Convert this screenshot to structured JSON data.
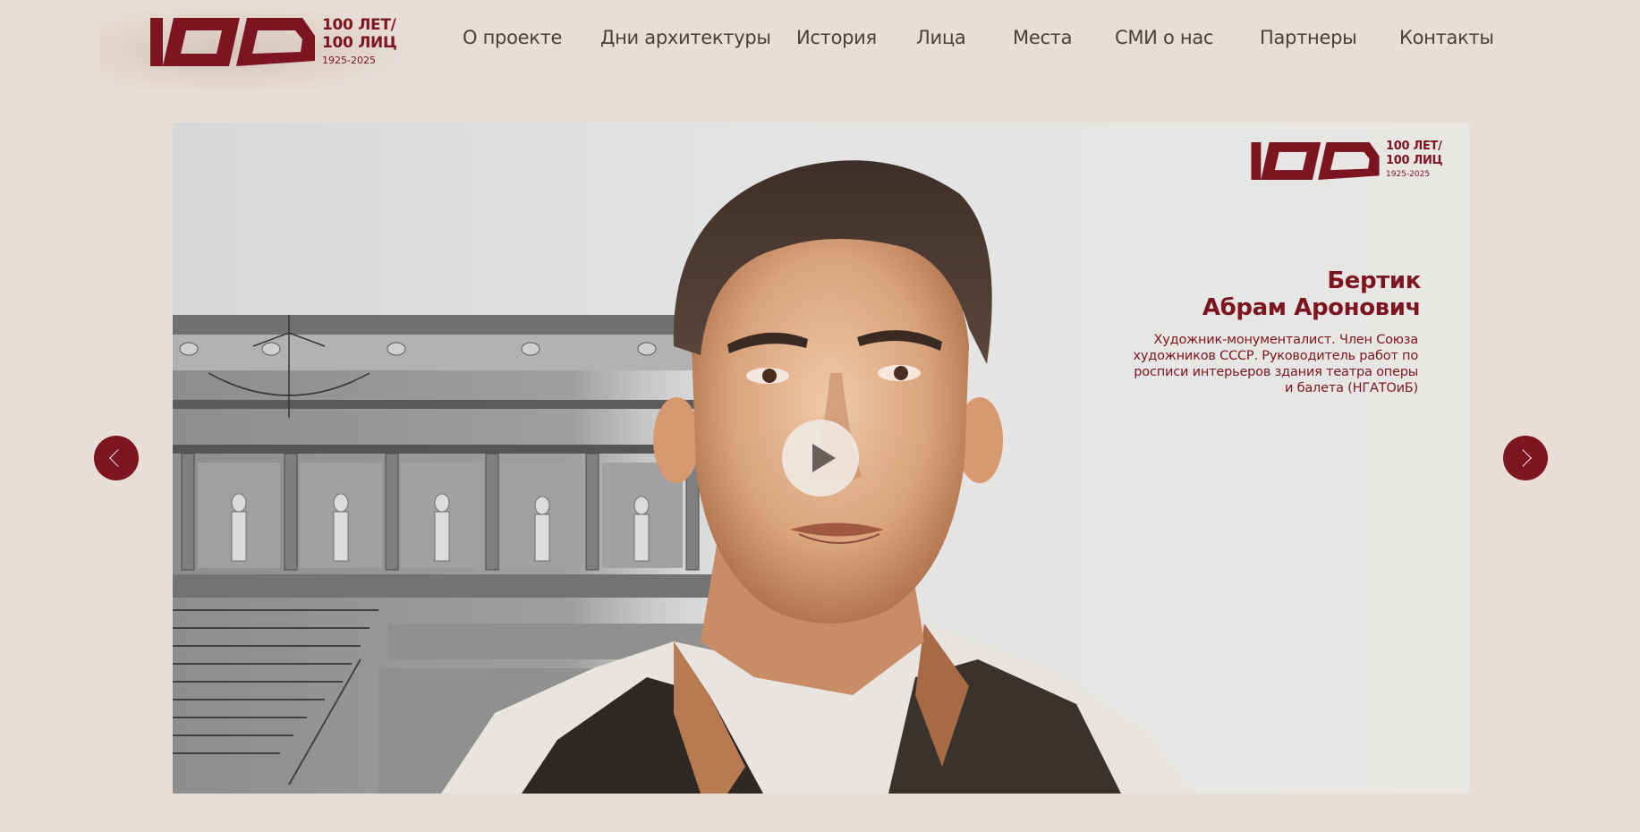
{
  "colors": {
    "background": "#e8ded5",
    "brand": "#7d1520",
    "nav_text": "#4a3f3b"
  },
  "header": {
    "logo": {
      "mark_text": "100",
      "line1": "100 ЛЕТ/",
      "line2": "100 ЛИЦ",
      "years": "1925-2025"
    },
    "nav": [
      {
        "label": "О проекте"
      },
      {
        "label": "Дни архитектуры"
      },
      {
        "label": "История"
      },
      {
        "label": "Лица"
      },
      {
        "label": "Места"
      },
      {
        "label": "СМИ о нас"
      },
      {
        "label": "Партнеры"
      },
      {
        "label": "Контакты"
      }
    ]
  },
  "slide": {
    "logo": {
      "line1": "100 ЛЕТ/",
      "line2": "100 ЛИЦ",
      "years": "1925-2025"
    },
    "name_line1": "Бертик",
    "name_line2": "Абрам Аронович",
    "description": "Художник-монументалист. Член Союза художников СССР. Руководитель работ по росписи интерьеров здания театра оперы и балета (НГАТОиБ)",
    "play_icon": "play-icon",
    "prev_icon": "chevron-left-icon",
    "next_icon": "chevron-right-icon"
  }
}
